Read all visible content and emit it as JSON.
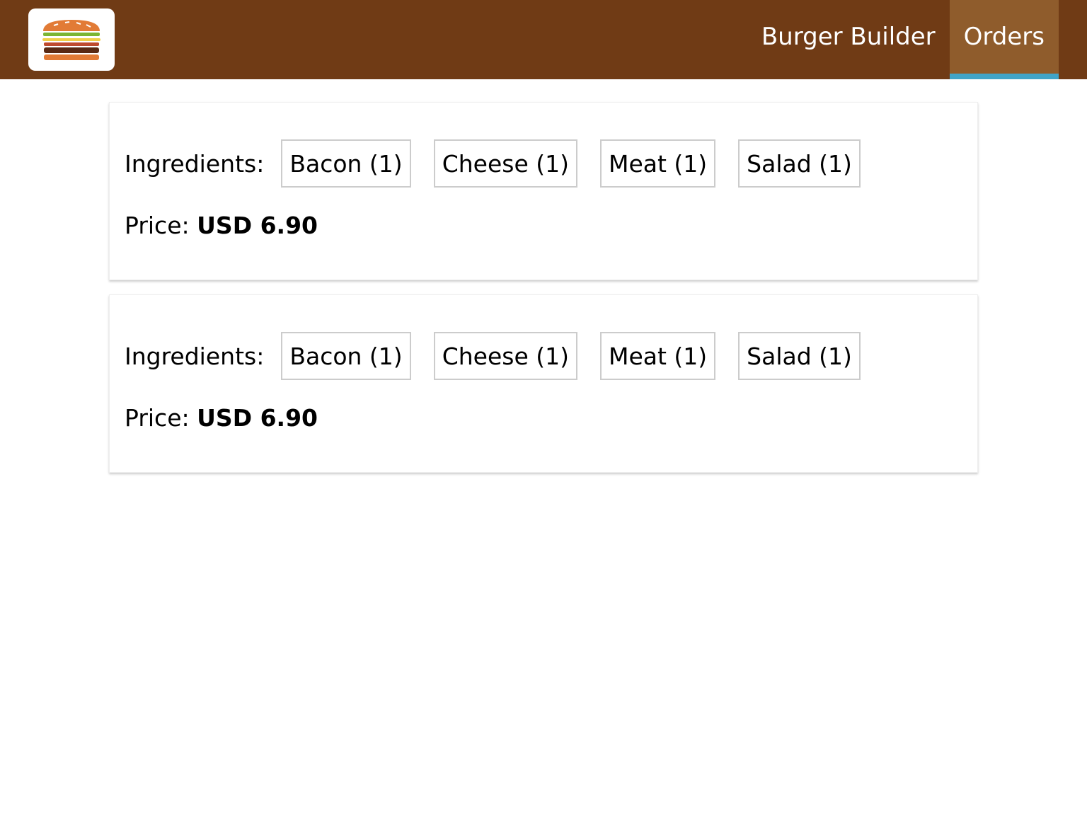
{
  "header": {
    "logo": "burger-logo",
    "nav": [
      {
        "label": "Burger Builder",
        "active": false
      },
      {
        "label": "Orders",
        "active": true
      }
    ],
    "colors": {
      "toolbar": "#703B15",
      "active_bg": "#8F5C2C",
      "active_underline": "#40A4C8"
    }
  },
  "orders": [
    {
      "ingredients_label": "Ingredients:",
      "ingredients": [
        "Bacon (1)",
        "Cheese (1)",
        "Meat (1)",
        "Salad (1)"
      ],
      "price_label": "Price:",
      "price_value": "USD 6.90"
    },
    {
      "ingredients_label": "Ingredients:",
      "ingredients": [
        "Bacon (1)",
        "Cheese (1)",
        "Meat (1)",
        "Salad (1)"
      ],
      "price_label": "Price:",
      "price_value": "USD 6.90"
    }
  ]
}
